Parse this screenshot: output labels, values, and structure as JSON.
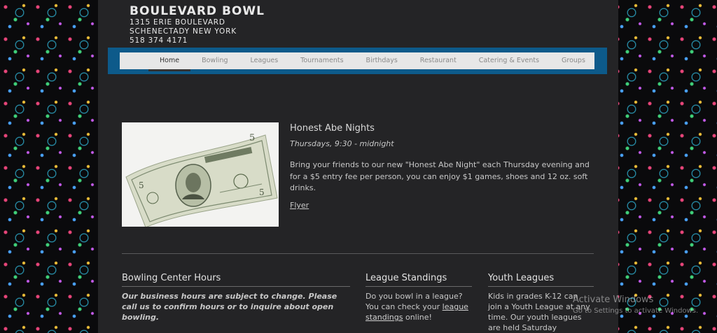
{
  "brand": {
    "name": "BOULEVARD BOWL",
    "address1": "1315 ERIE BOULEVARD",
    "address2": "SCHENECTADY  NEW YORK",
    "phone": "518   374   4171"
  },
  "nav": {
    "items": [
      {
        "label": "Home",
        "active": true
      },
      {
        "label": "Bowling"
      },
      {
        "label": "Leagues"
      },
      {
        "label": "Tournaments"
      },
      {
        "label": "Birthdays"
      },
      {
        "label": "Restaurant"
      },
      {
        "label": "Catering & Events"
      },
      {
        "label": "Groups"
      }
    ]
  },
  "feature": {
    "image_alt": "Five dollar bill",
    "title": "Honest Abe Nights",
    "subtitle": "Thursdays, 9:30 - midnight",
    "description": "Bring your friends to our new \"Honest Abe Night\" each Thursday evening and for a $5 entry fee per person, you can enjoy $1 games, shoes and 12 oz. soft drinks.",
    "link": "Flyer"
  },
  "hours": {
    "title": "Bowling Center Hours",
    "body": "Our business hours are subject to change. Please call us to confirm hours or to inquire about open bowling."
  },
  "standings": {
    "title": "League Standings",
    "text_before": "Do you bowl in a league? You can check your ",
    "link": "league standings",
    "text_after": " online!"
  },
  "youth": {
    "title": "Youth Leagues",
    "body": "Kids in grades K-12 can join a Youth League at any time. Our youth leagues are held Saturday"
  },
  "watermark": {
    "line1": "Activate Windows",
    "line2": "Go to Settings to activate Windows."
  }
}
